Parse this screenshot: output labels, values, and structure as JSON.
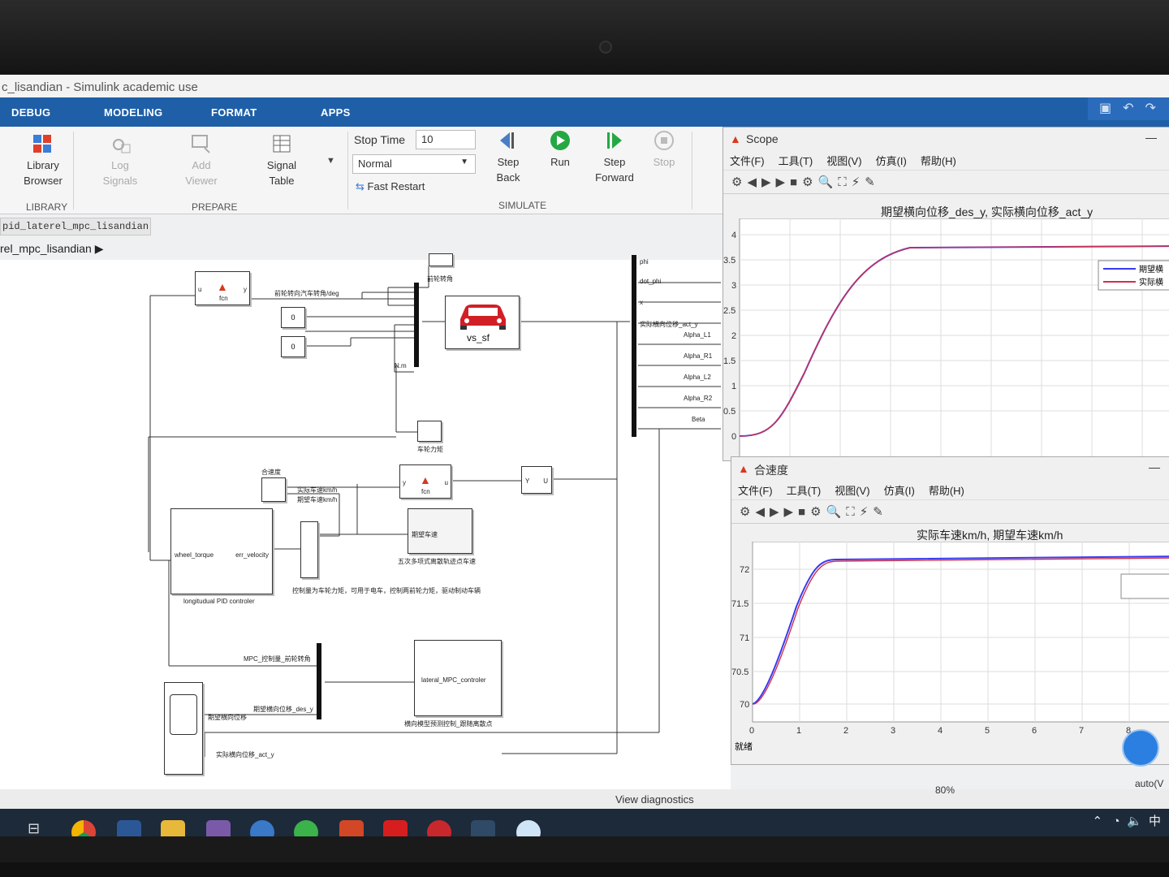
{
  "window": {
    "title": "c_lisandian - Simulink academic use"
  },
  "ribbon_tabs": [
    "DEBUG",
    "MODELING",
    "FORMAT",
    "APPS"
  ],
  "ribbon": {
    "library_browser": "Library Browser",
    "log_signals": "Log Signals",
    "add_viewer": "Add Viewer",
    "signal_table": "Signal Table",
    "library_group": "LIBRARY",
    "prepare_group": "PREPARE",
    "stop_time_label": "Stop Time",
    "stop_time_value": "10",
    "sim_mode": "Normal",
    "fast_restart": "Fast Restart",
    "step_back": "Step Back",
    "run": "Run",
    "step_forward": "Step Forward",
    "stop": "Stop",
    "simulate_group": "SIMULATE"
  },
  "model_tab": "pid_laterel_mpc_lisandian",
  "breadcrumb": "rel_mpc_lisandian",
  "diagram": {
    "fcn": "fcn",
    "fcn_in": "u",
    "fcn_out": "y",
    "front_wheel_signal": "前轮转向汽车转角/deg",
    "const0": "0",
    "const1": "0",
    "nm": "N.m",
    "vehicle": "vs_sf",
    "front_wheel_scope": "前轮转角",
    "wheel_torque_scope": "车轮力矩",
    "outputs": [
      "phi",
      "dot_phi",
      "x",
      "实际横向位移_act_y",
      "Alpha_L1",
      "Alpha_R1",
      "Alpha_L2",
      "Alpha_R2",
      "Beta"
    ],
    "speed_scope": "合速度",
    "actual_speed": "实际车速km/h",
    "desired_speed": "期望车速km/h",
    "fcn2_in": "y",
    "fcn2_out": "u",
    "yu_y": "Y",
    "yu_u": "U",
    "pid_in": "wheel_torque",
    "pid_out": "err_velocity",
    "pid_name": "longitudual PID controler",
    "poly_block": "期望车速",
    "poly_name": "五次多项式离散轨迹点车速",
    "control_note": "控制量为车轮力矩，可用于电车，控制两前轮力矩，驱动制动车辆",
    "mpc_front": "MPC_控制量_前轮转角",
    "mpc_block": "lateral_MPC_controler",
    "mpc_name": "横向模型预测控制_跟随离散点",
    "desired_lat_sig": "期望横向位移_des_y",
    "desired_lat": "期望横向位移",
    "actual_lat": "实际横向位移_act_y"
  },
  "scope1": {
    "title": "Scope",
    "menu": [
      "文件(F)",
      "工具(T)",
      "视图(V)",
      "仿真(I)",
      "帮助(H)"
    ],
    "plot_title": "期望横向位移_des_y, 实际横向位移_act_y",
    "legend": [
      "期望横",
      "实际横"
    ],
    "yticks": [
      "4",
      "3.5",
      "3",
      "2.5",
      "2",
      "1.5",
      "1",
      "0.5",
      "0"
    ]
  },
  "scope2": {
    "title": "合速度",
    "menu": [
      "文件(F)",
      "工具(T)",
      "视图(V)",
      "仿真(I)",
      "帮助(H)"
    ],
    "plot_title": "实际车速km/h, 期望车速km/h",
    "yticks": [
      "72",
      "71.5",
      "71",
      "70.5",
      "70"
    ],
    "xticks": [
      "0",
      "1",
      "2",
      "3",
      "4",
      "5",
      "6",
      "7",
      "8"
    ],
    "status": "就绪"
  },
  "status": {
    "diagnostics": "View diagnostics",
    "zoom": "80%",
    "solver": "auto(V"
  },
  "tray": {
    "ime": "中"
  },
  "colors": {
    "ribbon_blue": "#1e5fa8",
    "desired": "#3a3af0",
    "actual": "#d0304a"
  }
}
